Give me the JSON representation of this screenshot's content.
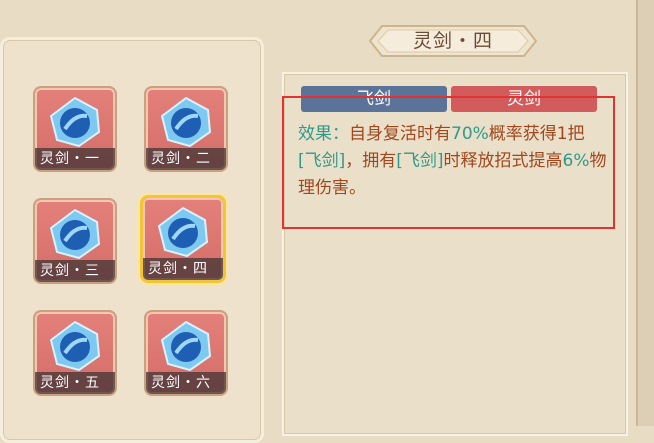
{
  "title": "灵剑・四",
  "slots": [
    {
      "label": "灵剑・一",
      "selected": false
    },
    {
      "label": "灵剑・二",
      "selected": false
    },
    {
      "label": "灵剑・三",
      "selected": false
    },
    {
      "label": "灵剑・四",
      "selected": true
    },
    {
      "label": "灵剑・五",
      "selected": false
    },
    {
      "label": "灵剑・六",
      "selected": false
    }
  ],
  "tabs": {
    "fly_sword": "飞剑",
    "spirit_sword": "灵剑"
  },
  "effect": {
    "label": "效果：",
    "text_1": "自身复活时有",
    "percent_1": "70%",
    "text_2": "概率获得1把",
    "keyword_1": "[飞剑]",
    "text_3": "，拥有",
    "keyword_2": "[飞剑]",
    "text_4": "时释放招式提高",
    "percent_2": "6%",
    "text_5": "物理伤害。"
  },
  "colors": {
    "accent_teal": "#2f9a8a",
    "body_text": "#a0471d",
    "tab_blue": "#5c7399",
    "tab_red": "#d25b5b",
    "selected_border": "#f2c43a",
    "highlight_box": "#e23333"
  }
}
